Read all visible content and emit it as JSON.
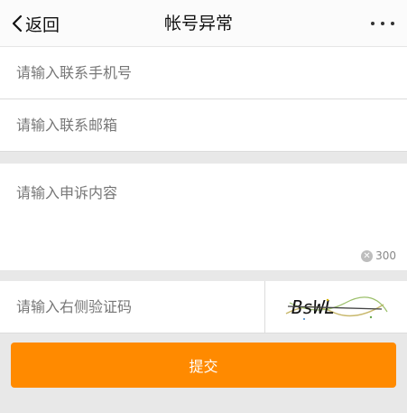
{
  "nav": {
    "back_label": "返回",
    "title": "帐号异常",
    "more_icon": "more-dots-icon"
  },
  "form": {
    "phone_placeholder": "请输入联系手机号",
    "email_placeholder": "请输入联系邮箱",
    "appeal_placeholder": "请输入申诉内容",
    "appeal_counter": "300",
    "captcha_placeholder": "请输入右侧验证码",
    "captcha_text": "BsWL"
  },
  "submit": {
    "label": "提交",
    "color": "#ff8a00"
  }
}
